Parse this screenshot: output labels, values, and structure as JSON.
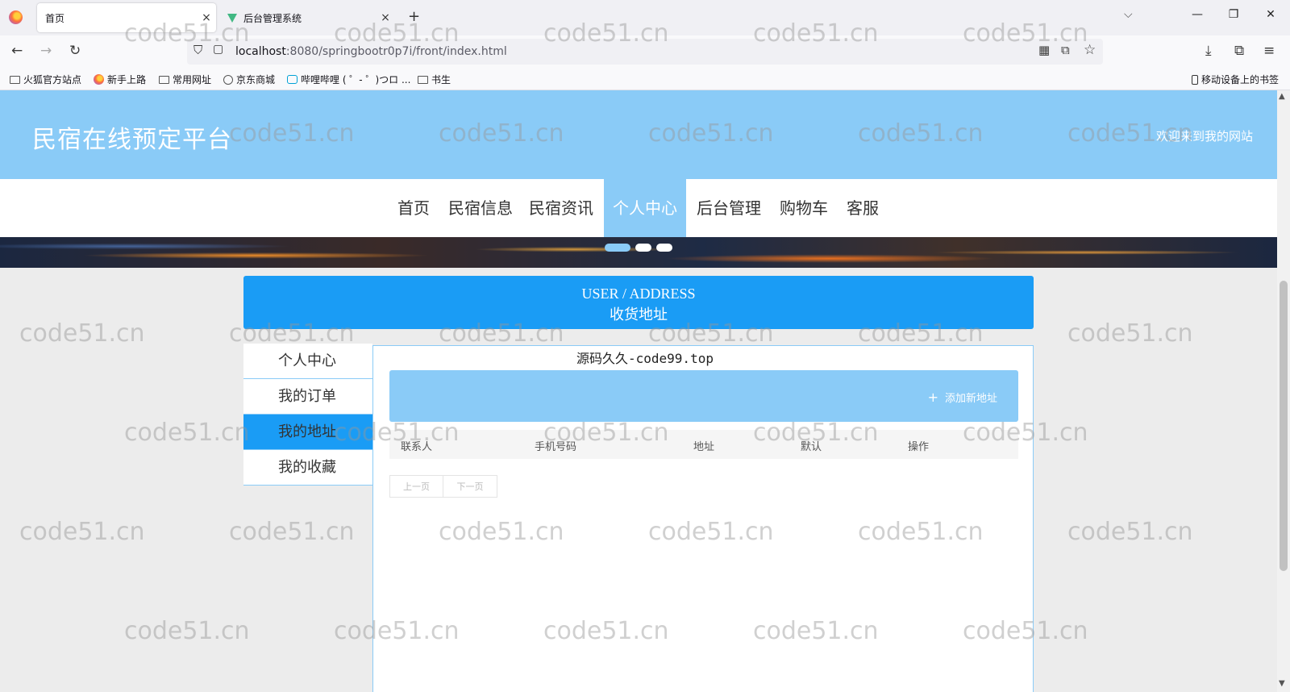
{
  "browser": {
    "tabs": [
      {
        "title": "首页",
        "close": "×"
      },
      {
        "title": "后台管理系统",
        "close": "×"
      }
    ],
    "new_tab": "+",
    "tabs_list": "⌵",
    "window": {
      "minimize": "—",
      "restore": "❐",
      "close": "✕"
    },
    "nav": {
      "back": "←",
      "forward": "→",
      "reload": "↻"
    },
    "url_host": "localhost",
    "url_path": ":8080/springbootr0p7i/front/index.html",
    "url_icons": {
      "shield": "⛉",
      "page": "▢",
      "qr": "▦",
      "pip": "⧉",
      "star": "☆"
    },
    "right_icons": {
      "download": "⤓",
      "extensions": "⧉",
      "menu": "≡"
    },
    "bookmarks": [
      {
        "label": "火狐官方站点",
        "icon": "folder-icon"
      },
      {
        "label": "新手上路",
        "icon": "firefox-icon"
      },
      {
        "label": "常用网址",
        "icon": "folder-icon"
      },
      {
        "label": "京东商城",
        "icon": "globe-icon"
      },
      {
        "label": "哔哩哔哩 ( ゜- ゜)つロ ...",
        "icon": "bilibili-icon"
      },
      {
        "label": "书生",
        "icon": "folder-icon"
      }
    ],
    "mobile_bookmarks": "移动设备上的书签"
  },
  "site": {
    "title": "民宿在线预定平台",
    "welcome": "欢迎来到我的网站",
    "menu": [
      {
        "label": "首页"
      },
      {
        "label": "民宿信息"
      },
      {
        "label": "民宿资讯"
      },
      {
        "label": "个人中心",
        "active": true
      },
      {
        "label": "后台管理"
      },
      {
        "label": "购物车"
      },
      {
        "label": "客服"
      }
    ]
  },
  "section": {
    "title_en": "USER / ADDRESS",
    "title_cn": "收货地址"
  },
  "sidebar": {
    "items": [
      {
        "label": "个人中心"
      },
      {
        "label": "我的订单"
      },
      {
        "label": "我的地址",
        "active": true
      },
      {
        "label": "我的收藏"
      }
    ]
  },
  "panel": {
    "watermark_text": "源码久久-code99.top",
    "add_button": "添加新地址",
    "plus": "+",
    "columns": [
      "联系人",
      "手机号码",
      "地址",
      "默认",
      "操作"
    ],
    "pager": {
      "prev": "上一页",
      "next": "下一页"
    }
  },
  "watermark": "code51.cn",
  "colors": {
    "accent": "#1a9cf5",
    "light_accent": "#8acbf7"
  }
}
